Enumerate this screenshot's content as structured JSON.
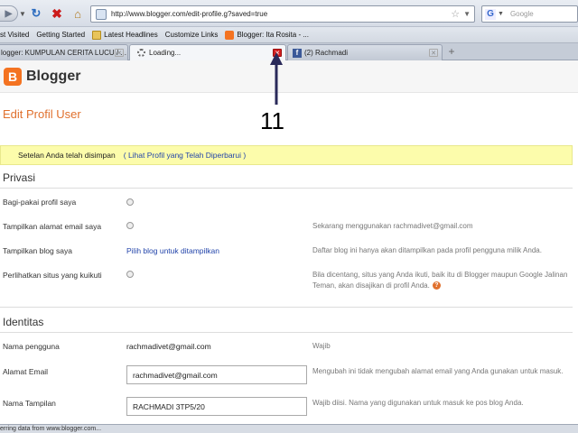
{
  "browser": {
    "url": "http://www.blogger.com/edit-profile.g?saved=true",
    "search_placeholder": "Google",
    "bookmarks": [
      {
        "label": "st Visited",
        "icon": "page-icon"
      },
      {
        "label": "Getting Started",
        "icon": "page-icon"
      },
      {
        "label": "Latest Headlines",
        "icon": "folder-icon"
      },
      {
        "label": "Customize Links",
        "icon": "page-icon"
      },
      {
        "label": "Blogger: Ita Rosita - ...",
        "icon": "blogger-icon"
      }
    ],
    "tabs": [
      {
        "label": "logger: KUMPULAN CERITA LUCU / ...",
        "active": false
      },
      {
        "label": "Loading...",
        "active": true
      },
      {
        "label": "(2) Rachmadi",
        "active": false
      }
    ],
    "status": "erring data from www.blogger.com..."
  },
  "page": {
    "brand": "Blogger",
    "title": "Edit Profil User",
    "notice": {
      "text": "Setelan Anda telah disimpan",
      "link": "( Lihat Profil yang Telah Diperbarui )"
    },
    "privasi": {
      "heading": "Privasi",
      "rows": [
        {
          "label": "Bagi-pakai profil saya",
          "help": ""
        },
        {
          "label": "Tampilkan alamat email saya",
          "help": "Sekarang menggunakan rachmadivet@gmail.com"
        },
        {
          "label": "Tampilkan blog saya",
          "link": "Pilih blog untuk ditampilkan",
          "help": "Daftar blog ini hanya akan ditampilkan pada profil pengguna milik Anda."
        },
        {
          "label": "Perlihatkan situs yang kuikuti",
          "help": "Bila dicentang, situs yang Anda ikuti, baik itu di Blogger maupun Google Jalinan Teman, akan disajikan di profil Anda."
        }
      ]
    },
    "identitas": {
      "heading": "Identitas",
      "username_label": "Nama pengguna",
      "username_value": "rachmadivet@gmail.com",
      "username_help": "Wajib",
      "email_label": "Alamat Email",
      "email_value": "rachmadivet@gmail.com",
      "email_help": "Mengubah ini tidak mengubah alamat email yang Anda gunakan untuk masuk.",
      "display_label": "Nama Tampilan",
      "display_value": "RACHMADI 3TP5/20",
      "display_help": "Wajib diisi. Nama yang digunakan untuk masuk ke pos blog Anda."
    }
  },
  "annotation": {
    "number": "11"
  }
}
